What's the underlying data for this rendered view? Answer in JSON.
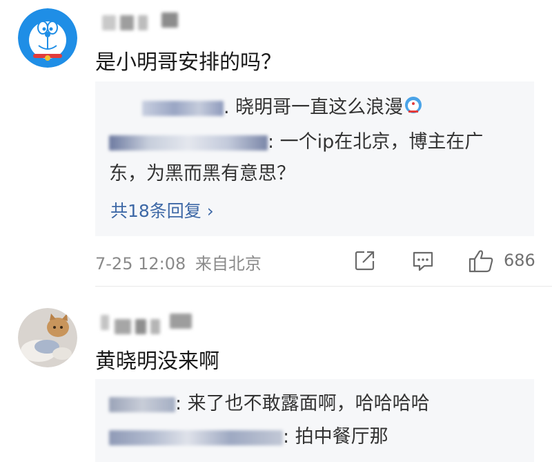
{
  "comments": [
    {
      "avatar": "doraemon-avatar",
      "text": "是小明哥安排的吗？",
      "replies": [
        {
          "text": ". 晓明哥一直这么浪漫"
        },
        {
          "text": ": 一个ip在北京，博主在广"
        },
        {
          "text": "东，为黑而黑有意思？"
        }
      ],
      "reply_count": "共18条回复 ›",
      "timestamp": "7-25 12:08",
      "location": "来自北京",
      "likes": "686",
      "icons": {
        "share": "share-icon",
        "comment": "comment-icon",
        "like": "thumbs-up-icon"
      }
    },
    {
      "avatar": "cat-avatar",
      "text": "黄晓明没来啊",
      "replies": [
        {
          "text": ": 来了也不敢露面啊，哈哈哈哈"
        },
        {
          "text": ": 拍中餐厅那"
        }
      ]
    }
  ],
  "colors": {
    "link": "#3d68a6",
    "reply_bg": "#f6f7f9",
    "meta": "#8a8a8a",
    "avatar_blue": "#1f8ee6"
  }
}
